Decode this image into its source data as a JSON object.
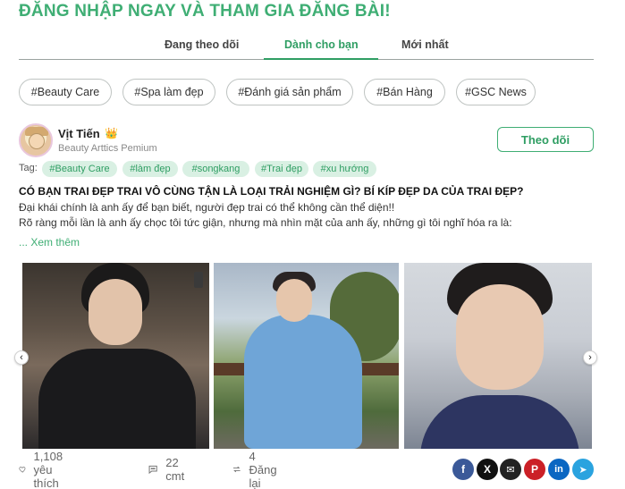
{
  "banner": {
    "text": "ĐĂNG NHẬP NGAY VÀ THAM GIA ĐĂNG BÀI!"
  },
  "tabs": [
    {
      "label": "Đang theo dõi"
    },
    {
      "label": "Dành cho bạn",
      "active": true
    },
    {
      "label": "Mới nhất"
    }
  ],
  "categories": [
    {
      "label": "#Beauty Care"
    },
    {
      "label": "#Spa làm đẹp"
    },
    {
      "label": "#Đánh giá sản phẩm"
    },
    {
      "label": "#Bán Hàng"
    },
    {
      "label": "#GSC News"
    }
  ],
  "post": {
    "author": {
      "name": "Vịt Tiến",
      "badge": "👑",
      "subtitle": "Beauty Arttics Pemium"
    },
    "follow_label": "Theo dõi",
    "tag_label": "Tag:",
    "tags": [
      "#Beauty Care",
      "#làm đẹp",
      "#songkang",
      "#Trai đẹp",
      "#xu hướng"
    ],
    "title": "CÓ BẠN TRAI ĐẸP TRAI VÔ CÙNG TẬN LÀ LOẠI TRẢI NGHIỆM GÌ? BÍ KÍP ĐẸP DA CỦA TRAI ĐẸP?",
    "lines": [
      "Đại khái chính là anh ấy để bạn biết, người đẹp trai có thể không cần thể diện!!",
      "Rõ ràng mỗi lần là anh ấy chọc tôi tức giận, nhưng mà nhìn mặt của anh ấy, những gì tôi nghĩ hóa ra là:"
    ],
    "see_more": "... Xem thêm",
    "gallery_nav": {
      "prev": "‹",
      "next": "›"
    },
    "stats": {
      "likes": "1,108 yêu thích",
      "comments": "22 cmt",
      "reposts": "4 Đăng lại"
    },
    "share": {
      "facebook": "f",
      "x": "X",
      "email": "✉",
      "pinterest": "P",
      "linkedin": "in",
      "telegram": "➤"
    }
  },
  "colors": {
    "accent": "#3fae74",
    "tag_bg": "#d9f0e3",
    "facebook": "#3b5998",
    "x": "#111111",
    "email": "#222222",
    "pinterest": "#cb2027",
    "linkedin": "#0a66c2",
    "telegram": "#2aa3df"
  }
}
